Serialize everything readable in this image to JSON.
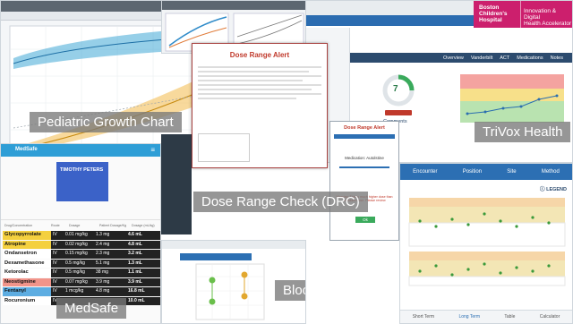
{
  "labels": {
    "growth": "Pediatric Growth Chart",
    "drc": "Dose Range Check (DRC)",
    "trivox": "TriVox Health",
    "medsafe": "MedSafe",
    "bp": "Blood Pressure Centiles"
  },
  "hospital": {
    "name_line1": "Boston",
    "name_line2": "Children's",
    "name_line3": "Hospital",
    "tag_line1": "Innovation & Digital",
    "tag_line2": "Health Accelerator"
  },
  "drc": {
    "title": "Dose Range Alert",
    "mini_title": "Dose Range Alert",
    "mini_sub": "Medication: Autolstine",
    "mini_warning": "Warning: This is much higher dose than standard dose. Please review",
    "mini_btn": "Ok"
  },
  "trivox": {
    "nav": [
      "Overview",
      "Vanderbilt",
      "ACT",
      "Medications",
      "Notes"
    ],
    "gauge_value": "7",
    "comments": "Comments"
  },
  "bp_right": {
    "nav": [
      "Encounter",
      "Position",
      "Site",
      "Method"
    ],
    "legend": "LEGEND",
    "footer": [
      "Short Term",
      "Long Term",
      "Table",
      "Calculator"
    ]
  },
  "medsafe": {
    "app": "MedSafe",
    "patient": "TIMOTHY PETERS",
    "header": [
      "Drug/Concentration",
      "Route",
      "Dosage",
      "Patient Dosage/Kg",
      "Dosage (mL/kg)"
    ],
    "rows": [
      {
        "drug": "Glycopyrrolate",
        "route": "IV",
        "dose": "0.01 mg/kg",
        "amt": "1.3 mg",
        "vol": "4.6 mL",
        "color": "#f4d03f"
      },
      {
        "drug": "Atropine",
        "route": "IV",
        "dose": "0.02 mg/kg",
        "amt": "2.4 mg",
        "vol": "4.8 mL",
        "color": "#f4d03f"
      },
      {
        "drug": "Ondansetron",
        "route": "IV",
        "dose": "0.15 mg/kg",
        "amt": "2.3 mg",
        "vol": "3.2 mL",
        "color": "#ffffff"
      },
      {
        "drug": "Dexamethasone",
        "route": "IV",
        "dose": "0.5 mg/kg",
        "amt": "5.1 mg",
        "vol": "1.3 mL",
        "color": "#ffffff"
      },
      {
        "drug": "Ketorolac",
        "route": "IV",
        "dose": "0.5 mg/kg",
        "amt": "38 mg",
        "vol": "1.1 mL",
        "color": "#ffffff"
      },
      {
        "drug": "Neostigmine",
        "route": "IV",
        "dose": "0.07 mg/kg",
        "amt": "3.9 mg",
        "vol": "3.9 mL",
        "color": "#f1948a"
      },
      {
        "drug": "Fentanyl",
        "route": "IV",
        "dose": "1 mcg/kg",
        "amt": "4.8 mg",
        "vol": "16.8 mL",
        "color": "#5dade2"
      },
      {
        "drug": "Rocuronium",
        "route": "IV",
        "dose": "",
        "amt": "",
        "vol": "10.0 mL",
        "color": "#ffffff"
      }
    ]
  }
}
